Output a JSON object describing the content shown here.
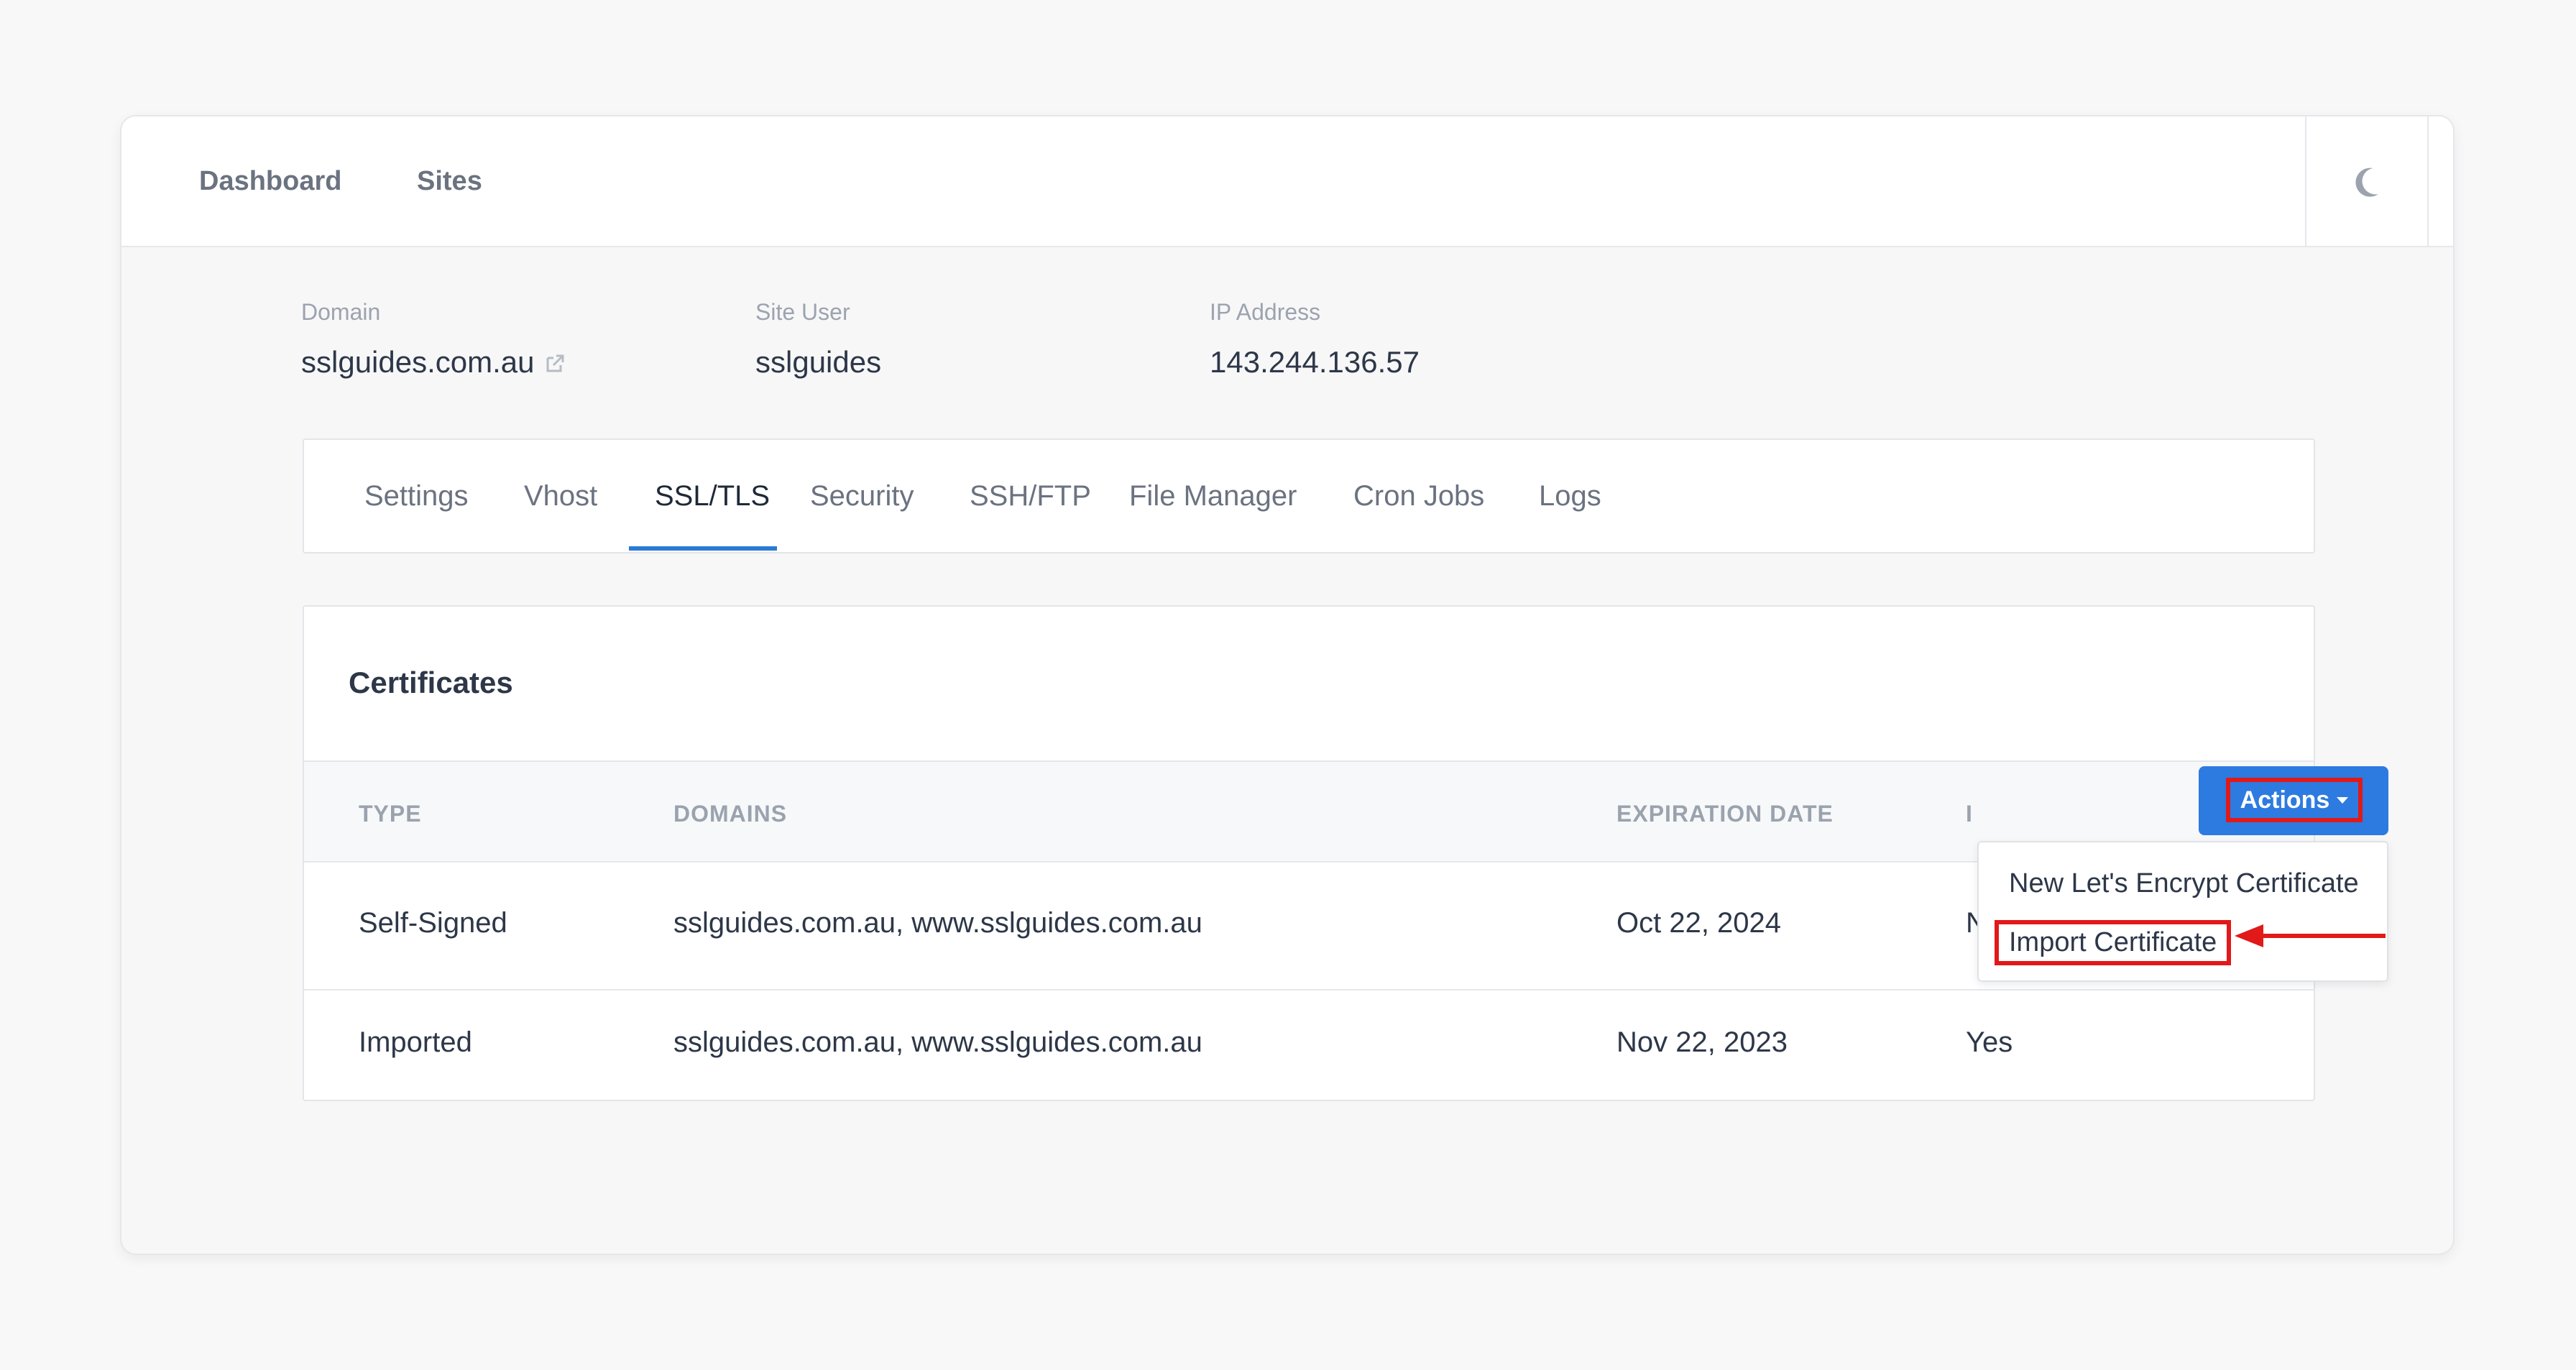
{
  "nav": {
    "dashboard": "Dashboard",
    "sites": "Sites",
    "theme_icon": "moon-icon"
  },
  "site": {
    "domain_label": "Domain",
    "domain_value": "sslguides.com.au",
    "user_label": "Site User",
    "user_value": "sslguides",
    "ip_label": "IP Address",
    "ip_value": "143.244.136.57"
  },
  "tabs": [
    {
      "label": "Settings"
    },
    {
      "label": "Vhost"
    },
    {
      "label": "SSL/TLS",
      "active": true
    },
    {
      "label": "Security"
    },
    {
      "label": "SSH/FTP"
    },
    {
      "label": "File Manager"
    },
    {
      "label": "Cron Jobs"
    },
    {
      "label": "Logs"
    }
  ],
  "certificates": {
    "title": "Certificates",
    "actions_label": "Actions",
    "menu": {
      "item1": "New Let's Encrypt Certificate",
      "item2": "Import Certificate"
    },
    "columns": {
      "type": "TYPE",
      "domains": "DOMAINS",
      "expiration": "EXPIRATION DATE",
      "in_use_partial": "I"
    },
    "rows": [
      {
        "type": "Self-Signed",
        "domains": "sslguides.com.au, www.sslguides.com.au",
        "expiration": "Oct 22, 2024",
        "in_use": "No"
      },
      {
        "type": "Imported",
        "domains": "sslguides.com.au, www.sslguides.com.au",
        "expiration": "Nov 22, 2023",
        "in_use": "Yes"
      }
    ]
  },
  "colors": {
    "accent": "#2d7be0",
    "highlight": "#e11919"
  }
}
